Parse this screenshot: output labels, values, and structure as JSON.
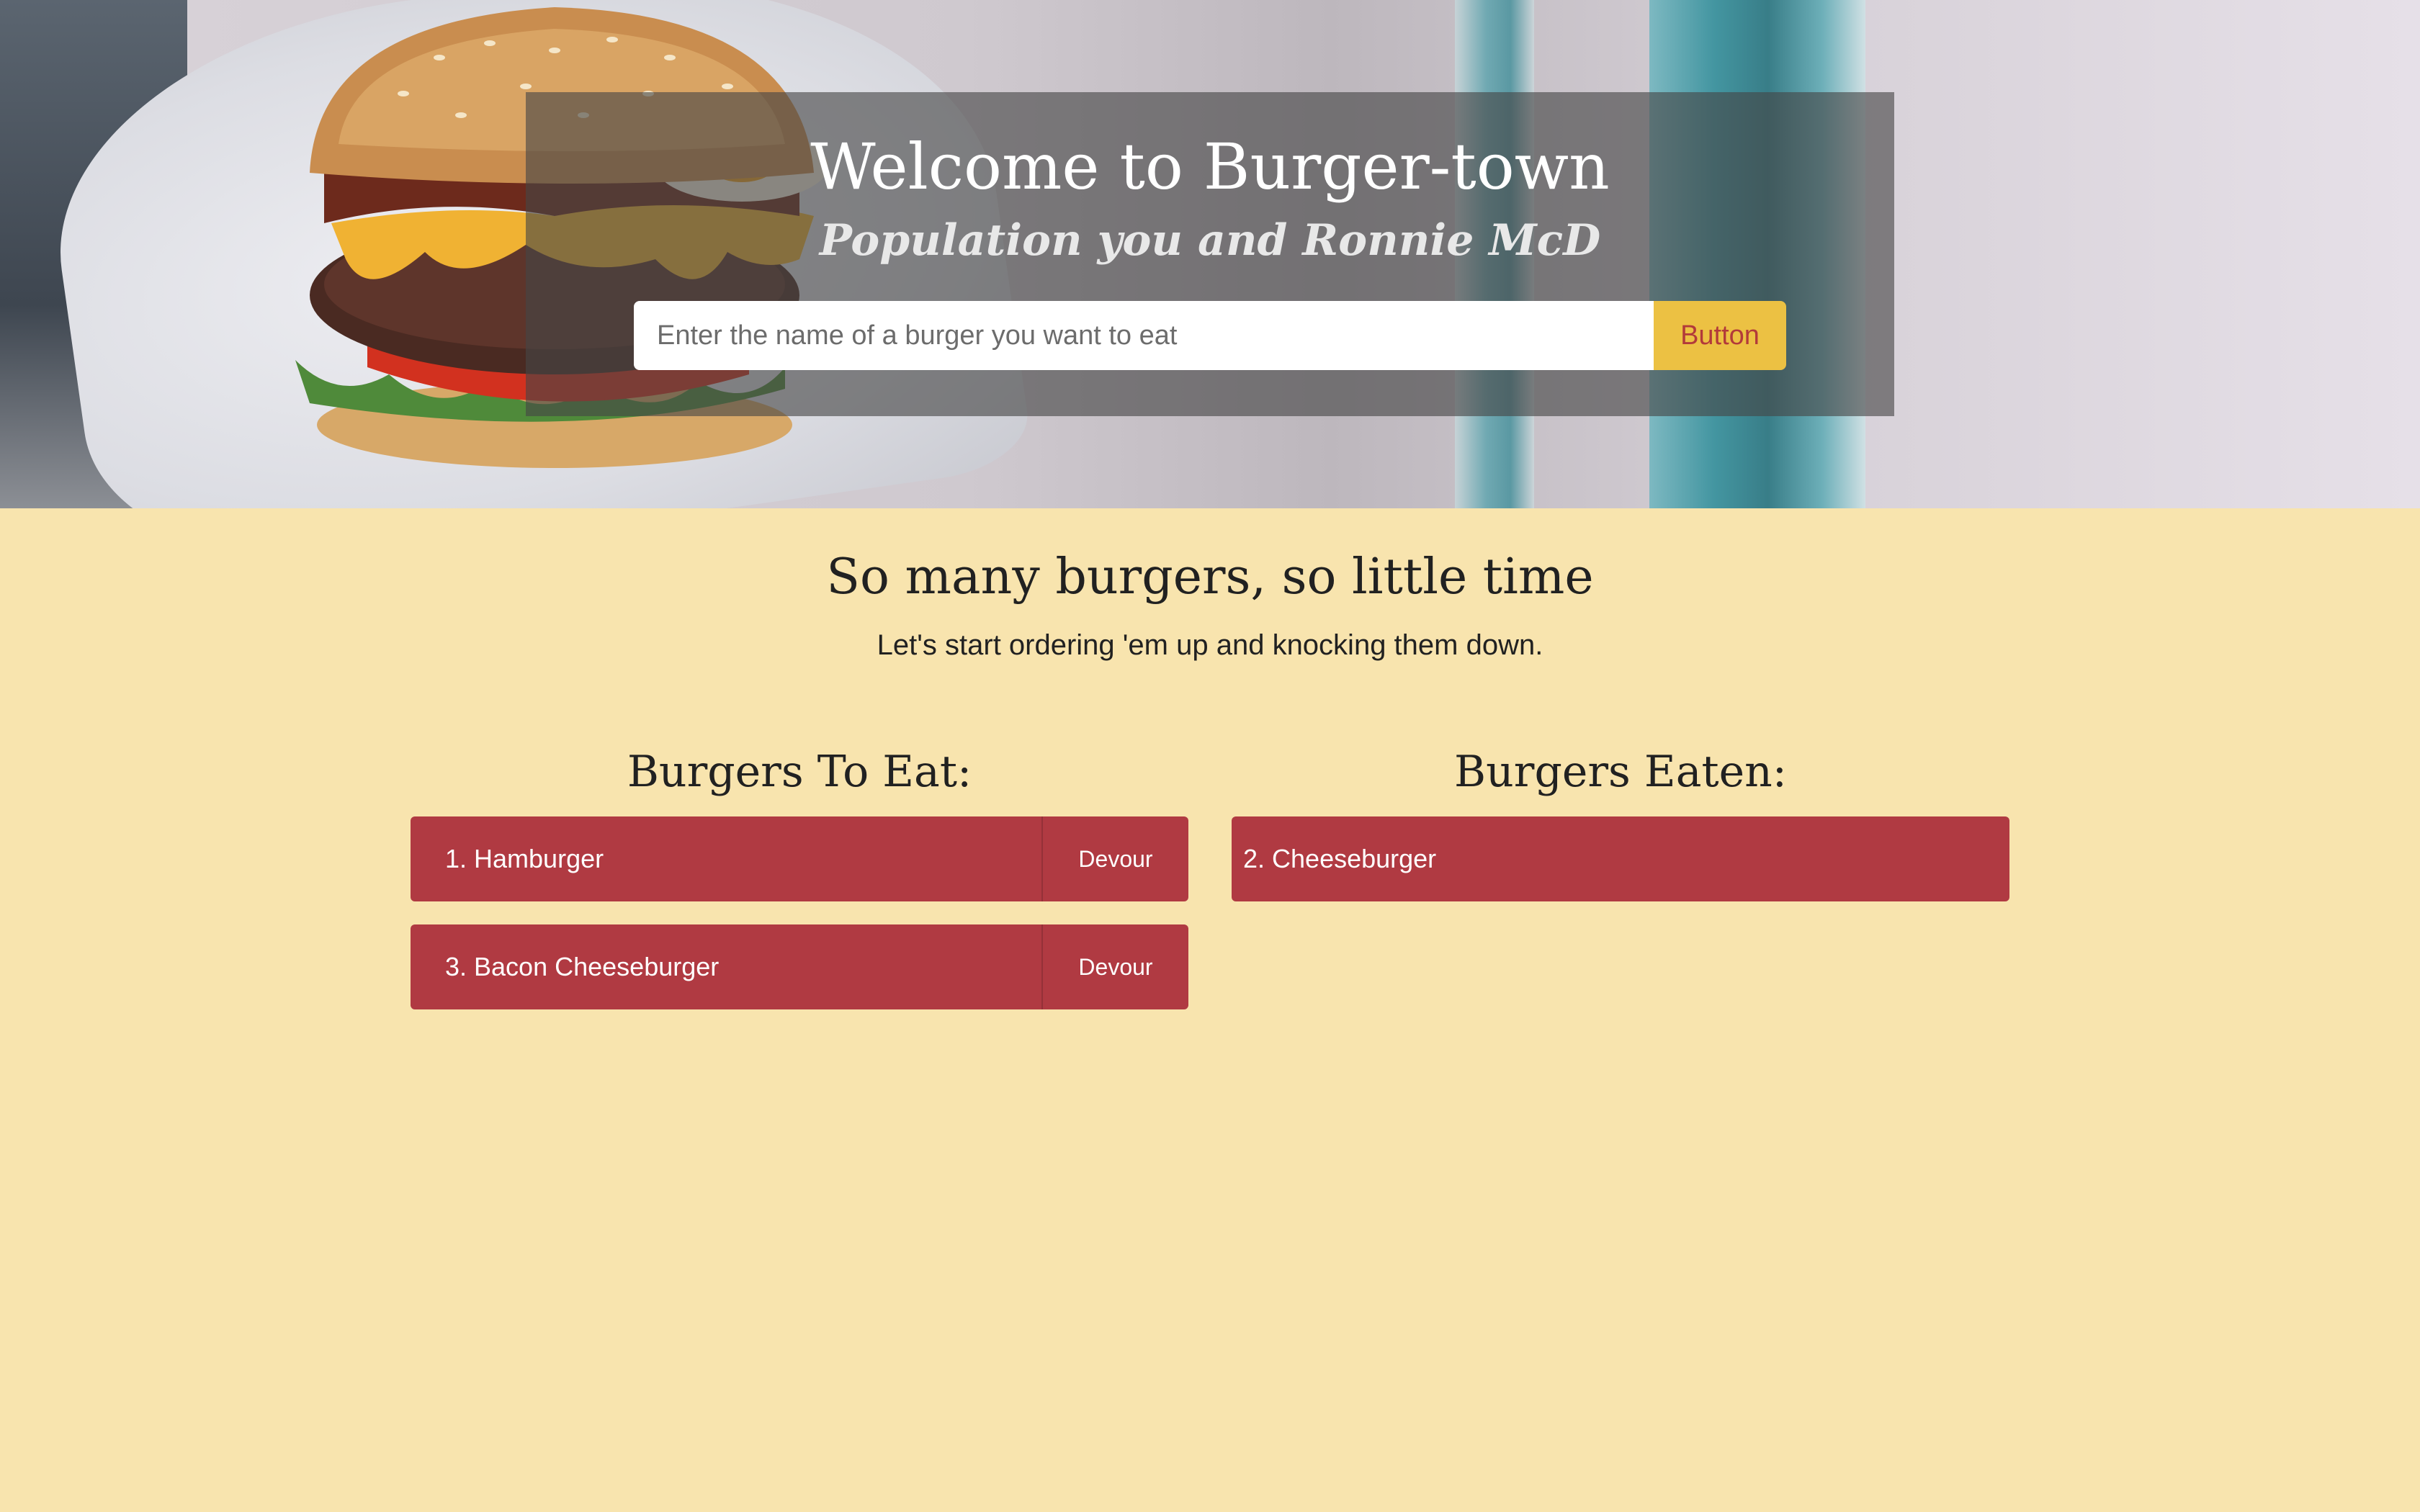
{
  "hero": {
    "title": "Welcome to Burger-town",
    "subtitle": "Population you and Ronnie McD",
    "search": {
      "placeholder": "Enter the name of a burger you want to eat",
      "value": "",
      "button_label": "Button"
    }
  },
  "main": {
    "heading": "So many burgers, so little time",
    "subheading": "Let's start ordering 'em up and knocking them down."
  },
  "to_eat": {
    "title": "Burgers To Eat:",
    "items": [
      {
        "label": "1. Hamburger",
        "action": "Devour"
      },
      {
        "label": "3. Bacon Cheeseburger",
        "action": "Devour"
      }
    ]
  },
  "eaten": {
    "title": "Burgers Eaten:",
    "items": [
      {
        "label": "2. Cheeseburger"
      }
    ]
  },
  "colors": {
    "page_background": "#f8e4ae",
    "item_background": "#b03a42",
    "button_background": "#ecc143",
    "button_text": "#b23a3a"
  }
}
